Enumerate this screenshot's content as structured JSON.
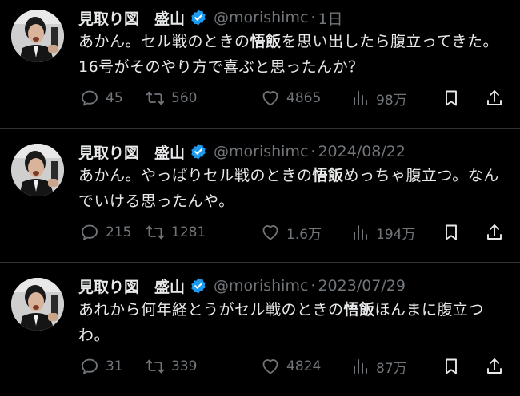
{
  "colors": {
    "background": "#000000",
    "text": "#e7e9ea",
    "muted": "#71767b",
    "verified": "#1d9bf0",
    "divider": "#2f3336"
  },
  "tweets": [
    {
      "name": "見取り図　盛山",
      "handle": "@morishimc",
      "dot": "·",
      "date": "1日",
      "text_parts": [
        "あかん。セル戦のときの",
        "悟飯",
        "を思い出したら腹立ってきた。16号がそのやり方で喜ぶと思ったんか？"
      ],
      "replies": "45",
      "retweets": "560",
      "likes": "4865",
      "views": "98万"
    },
    {
      "name": "見取り図　盛山",
      "handle": "@morishimc",
      "dot": "·",
      "date": "2024/08/22",
      "text_parts": [
        "あかん。やっぱりセル戦のときの",
        "悟飯",
        "めっちゃ腹立つ。なんでいける思ったんや。"
      ],
      "replies": "215",
      "retweets": "1281",
      "likes": "1.6万",
      "views": "194万"
    },
    {
      "name": "見取り図　盛山",
      "handle": "@morishimc",
      "dot": "·",
      "date": "2023/07/29",
      "text_parts": [
        "あれから何年経とうがセル戦のときの",
        "悟飯",
        "ほんまに腹立つわ。"
      ],
      "replies": "31",
      "retweets": "339",
      "likes": "4824",
      "views": "87万"
    }
  ],
  "icons": {
    "avatar": "avatar-photo",
    "verified": "verified-badge-icon",
    "more": "more-icon",
    "reply": "reply-icon",
    "retweet": "retweet-icon",
    "like": "like-icon",
    "views": "views-icon",
    "bookmark": "bookmark-icon",
    "share": "share-icon"
  }
}
